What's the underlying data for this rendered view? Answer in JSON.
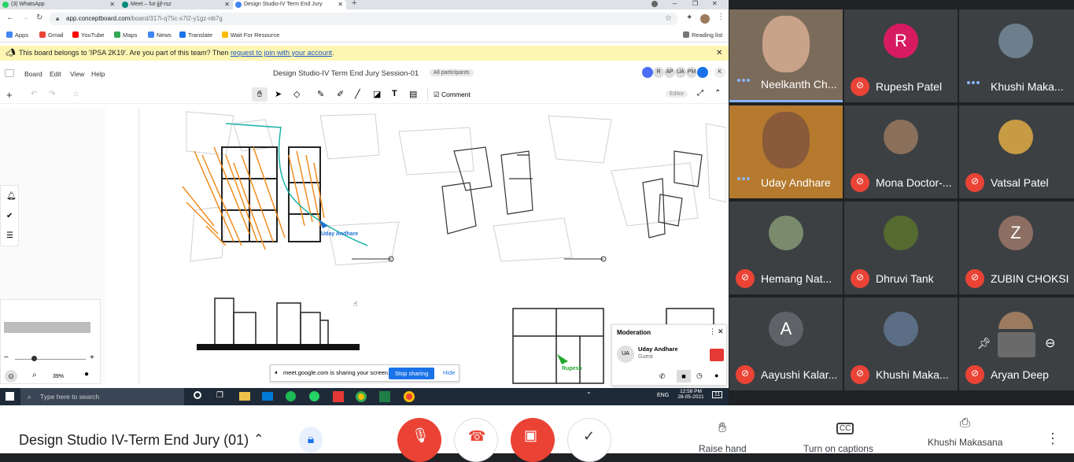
{
  "browser": {
    "tabs": [
      "(3) WhatsApp",
      "Meet – fut-jjjf-rsz",
      "Design Studio-IV Term End Jury"
    ],
    "url_host": "app.conceptboard.com",
    "url_path": "/board/317i-q75c-x7l2-y1gz-nb7g",
    "bookmarks": [
      "Apps",
      "Gmail",
      "YouTube",
      "Maps",
      "News",
      "Translate",
      "Wait For Resource",
      "Reading list"
    ]
  },
  "board": {
    "banner_text": "This board belongs to 'IPSA 2K19'. Are you part of this team? Then ",
    "banner_link": "request to join with your account",
    "banner_end": ".",
    "menu": [
      "Board",
      "Edit",
      "View",
      "Help"
    ],
    "title": "Design Studio-IV Term End Jury Session-01",
    "participants_badge": "All participants",
    "avatars": [
      "R",
      "AP",
      "UA",
      "PM"
    ],
    "avatar_user": "K",
    "comment_label": "Comment",
    "editor_label": "Editor",
    "zoom": "39%",
    "cursor_uday": "Uday Andhare",
    "cursor_rupesh": "Rupesh",
    "moderation": {
      "title": "Moderation",
      "user_initials": "UA",
      "user_name": "Uday Andhare",
      "user_role": "Guest"
    },
    "share_notice": "meet.google.com is sharing your screen.",
    "stop_sharing": "Stop sharing",
    "hide": "Hide"
  },
  "taskbar": {
    "search_placeholder": "Type here to search",
    "lang": "ENG",
    "time": "12:58 PM",
    "date": "28-05-2021",
    "notif_count": "11"
  },
  "meeting": {
    "name": "Design Studio IV-Term End Jury (01)",
    "raise_hand": "Raise hand",
    "captions": "Turn on captions",
    "presenting": "Khushi Makasana"
  },
  "participants": [
    {
      "name": "Neelkanth Ch...",
      "type": "video",
      "speaking": true
    },
    {
      "name": "Rupesh Patel",
      "type": "letter",
      "letter": "R",
      "color": "#d81b60",
      "muted": true
    },
    {
      "name": "Khushi Maka...",
      "type": "photo",
      "muted": false
    },
    {
      "name": "Uday Andhare",
      "type": "video",
      "muted": false
    },
    {
      "name": "Mona Doctor-...",
      "type": "photo",
      "muted": true
    },
    {
      "name": "Vatsal Patel",
      "type": "photo",
      "muted": true
    },
    {
      "name": "Hemang Nat...",
      "type": "photo",
      "muted": true
    },
    {
      "name": "Dhruvi Tank",
      "type": "photo",
      "muted": true
    },
    {
      "name": "ZUBIN CHOKSI",
      "type": "letter",
      "letter": "Z",
      "color": "#8d6e63",
      "muted": true
    },
    {
      "name": "Aayushi Kalar...",
      "type": "letter",
      "letter": "A",
      "color": "#5f6368",
      "muted": true
    },
    {
      "name": "Khushi Maka...",
      "type": "photo",
      "muted": true
    },
    {
      "name": "Aryan Deep",
      "type": "photo",
      "muted": true
    }
  ]
}
